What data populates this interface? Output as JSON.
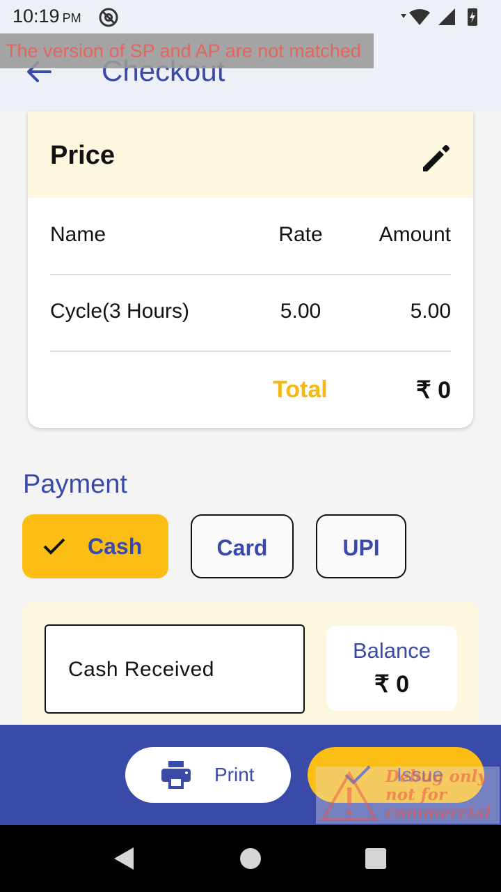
{
  "status_bar": {
    "time": "10:19",
    "ampm": "PM"
  },
  "debug_banner": {
    "text": "The version of SP and AP are not matched"
  },
  "app_bar": {
    "title": "Checkout"
  },
  "price_card": {
    "title": "Price",
    "columns": {
      "name": "Name",
      "rate": "Rate",
      "amount": "Amount"
    },
    "rows": [
      {
        "name": "Cycle(3 Hours)",
        "rate": "5.00",
        "amount": "5.00"
      }
    ],
    "total_label": "Total",
    "total_value": "₹ 0"
  },
  "payment": {
    "title": "Payment",
    "methods": [
      {
        "label": "Cash",
        "selected": true
      },
      {
        "label": "Card",
        "selected": false
      },
      {
        "label": "UPI",
        "selected": false
      }
    ]
  },
  "cash": {
    "input_placeholder": "Cash Received",
    "balance_label": "Balance",
    "balance_value": "₹ 0"
  },
  "actions": {
    "print_label": "Print",
    "issue_label": "Issue"
  },
  "watermark": {
    "lines": [
      "Debug only",
      "not for",
      "commercial"
    ]
  },
  "colors": {
    "primary": "#3a4aa8",
    "accent": "#fcbe15",
    "header_bg": "#eef0f8",
    "card_header_bg": "#fef7df"
  }
}
